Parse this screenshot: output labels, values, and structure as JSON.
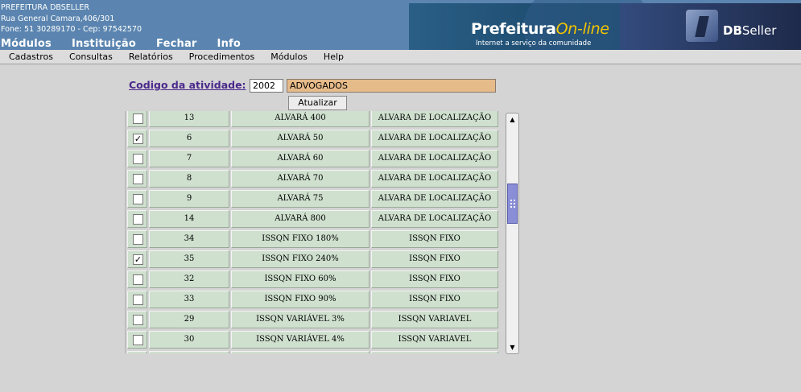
{
  "header": {
    "org_name": "PREFEITURA DBSELLER",
    "address": "Rua General Camara,406/301",
    "contact": "Fone: 51 30289170  -  Cep: 97542570",
    "top_menu": [
      "Módulos",
      "Instituição",
      "Fechar",
      "Info"
    ],
    "banner": {
      "brand_main": "Prefeitura",
      "brand_accent": "On-line",
      "tagline": "Internet a serviço da comunidade"
    },
    "vendor": {
      "bold": "DB",
      "normal": "Seller"
    }
  },
  "menubar": [
    "Cadastros",
    "Consultas",
    "Relatórios",
    "Procedimentos",
    "Módulos",
    "Help"
  ],
  "form": {
    "activity_label": "Codigo da atividade:",
    "activity_code": "2002",
    "activity_desc": "ADVOGADOS",
    "update_button": "Atualizar"
  },
  "rows": [
    {
      "checked": false,
      "code": "13",
      "name": "ALVARÁ 400",
      "type": "ALVARA DE LOCALIZAÇÃO"
    },
    {
      "checked": true,
      "code": "6",
      "name": "ALVARÁ 50",
      "type": "ALVARA DE LOCALIZAÇÃO"
    },
    {
      "checked": false,
      "code": "7",
      "name": "ALVARÁ 60",
      "type": "ALVARA DE LOCALIZAÇÃO"
    },
    {
      "checked": false,
      "code": "8",
      "name": "ALVARÁ 70",
      "type": "ALVARA DE LOCALIZAÇÃO"
    },
    {
      "checked": false,
      "code": "9",
      "name": "ALVARÁ 75",
      "type": "ALVARA DE LOCALIZAÇÃO"
    },
    {
      "checked": false,
      "code": "14",
      "name": "ALVARÁ 800",
      "type": "ALVARA DE LOCALIZAÇÃO"
    },
    {
      "checked": false,
      "code": "34",
      "name": "ISSQN FIXO 180%",
      "type": "ISSQN FIXO"
    },
    {
      "checked": true,
      "code": "35",
      "name": "ISSQN FIXO 240%",
      "type": "ISSQN FIXO"
    },
    {
      "checked": false,
      "code": "32",
      "name": "ISSQN FIXO 60%",
      "type": "ISSQN FIXO"
    },
    {
      "checked": false,
      "code": "33",
      "name": "ISSQN FIXO 90%",
      "type": "ISSQN FIXO"
    },
    {
      "checked": false,
      "code": "29",
      "name": "ISSQN VARIÁVEL 3%",
      "type": "ISSQN VARIAVEL"
    },
    {
      "checked": false,
      "code": "30",
      "name": "ISSQN VARIÁVEL 4%",
      "type": "ISSQN VARIAVEL"
    },
    {
      "checked": false,
      "code": "",
      "name": "",
      "type": ""
    }
  ],
  "scrollbar": {
    "up_icon": "arrow-up-icon",
    "down_icon": "arrow-down-icon",
    "position": 0.33
  }
}
